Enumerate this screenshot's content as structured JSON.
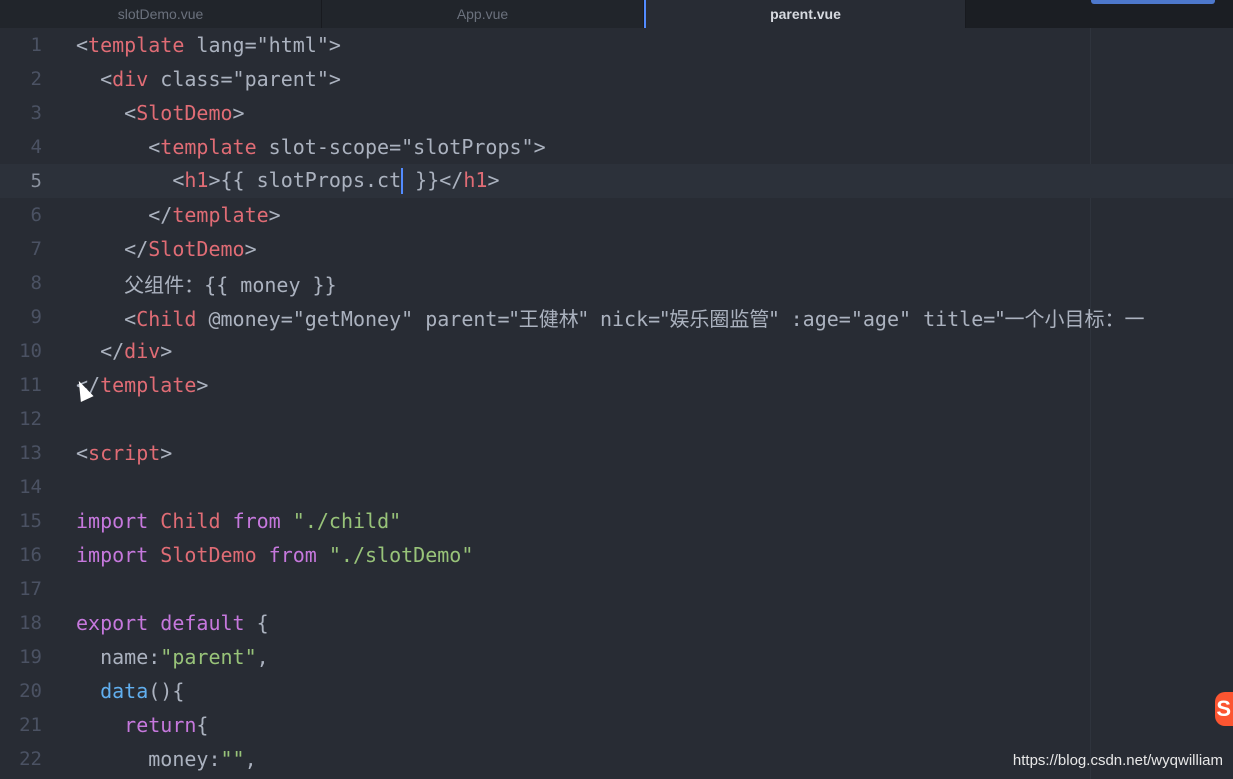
{
  "tabs": [
    {
      "label": "slotDemo.vue",
      "active": false
    },
    {
      "label": "App.vue",
      "active": false
    },
    {
      "label": "parent.vue",
      "active": true
    }
  ],
  "colors": {
    "background": "#282c34",
    "tag": "#e06c75",
    "attribute": "#d19a66",
    "string": "#98c379",
    "keyword": "#c678dd",
    "function": "#61afef",
    "cursor": "#528bff"
  },
  "editor": {
    "cursor_line": 5,
    "lines": [
      {
        "n": "1",
        "t": [
          [
            "<",
            "t-plain"
          ],
          [
            "template",
            "t-tag"
          ],
          [
            " lang=",
            "t-plain"
          ],
          [
            "\"html\"",
            "t-plain"
          ],
          [
            ">",
            "t-plain"
          ]
        ]
      },
      {
        "n": "2",
        "t": [
          [
            "  <",
            "t-plain"
          ],
          [
            "div",
            "t-tag"
          ],
          [
            " class=",
            "t-plain"
          ],
          [
            "\"parent\"",
            "t-plain"
          ],
          [
            ">",
            "t-plain"
          ]
        ]
      },
      {
        "n": "3",
        "t": [
          [
            "    <",
            "t-plain"
          ],
          [
            "SlotDemo",
            "t-tag"
          ],
          [
            ">",
            "t-plain"
          ]
        ]
      },
      {
        "n": "4",
        "t": [
          [
            "      <",
            "t-plain"
          ],
          [
            "template",
            "t-tag"
          ],
          [
            " slot-scope=",
            "t-plain"
          ],
          [
            "\"slotProps\"",
            "t-plain"
          ],
          [
            ">",
            "t-plain"
          ]
        ]
      },
      {
        "n": "5",
        "t": [
          [
            "        <",
            "t-plain"
          ],
          [
            "h1",
            "t-tag"
          ],
          [
            ">{{ slotProps.ct",
            "t-plain"
          ],
          [
            "|",
            "caret"
          ],
          [
            " }}</",
            "t-plain"
          ],
          [
            "h1",
            "t-tag"
          ],
          [
            ">",
            "t-plain"
          ]
        ]
      },
      {
        "n": "6",
        "t": [
          [
            "      </",
            "t-plain"
          ],
          [
            "template",
            "t-tag"
          ],
          [
            ">",
            "t-plain"
          ]
        ]
      },
      {
        "n": "7",
        "t": [
          [
            "    </",
            "t-plain"
          ],
          [
            "SlotDemo",
            "t-tag"
          ],
          [
            ">",
            "t-plain"
          ]
        ]
      },
      {
        "n": "8",
        "t": [
          [
            "    ",
            "t-plain"
          ],
          [
            "父组件：",
            "t-plain t-cjk"
          ],
          [
            "{{ money }}",
            "t-plain"
          ]
        ]
      },
      {
        "n": "9",
        "t": [
          [
            "    <",
            "t-plain"
          ],
          [
            "Child",
            "t-tag"
          ],
          [
            " @money=",
            "t-plain"
          ],
          [
            "\"getMoney\"",
            "t-plain"
          ],
          [
            " parent=",
            "t-plain"
          ],
          [
            "\"王健林\"",
            "t-plain t-cjk"
          ],
          [
            " nick=",
            "t-plain"
          ],
          [
            "\"娱乐圈监管\"",
            "t-plain t-cjk"
          ],
          [
            " :age=",
            "t-plain"
          ],
          [
            "\"age\"",
            "t-plain"
          ],
          [
            " title=",
            "t-plain"
          ],
          [
            "\"一个小目标：一",
            "t-plain t-cjk"
          ]
        ]
      },
      {
        "n": "10",
        "t": [
          [
            "  </",
            "t-plain"
          ],
          [
            "div",
            "t-tag"
          ],
          [
            ">",
            "t-plain"
          ]
        ]
      },
      {
        "n": "11",
        "t": [
          [
            "</",
            "t-plain"
          ],
          [
            "template",
            "t-tag"
          ],
          [
            ">",
            "t-plain"
          ]
        ]
      },
      {
        "n": "12",
        "t": []
      },
      {
        "n": "13",
        "t": [
          [
            "<",
            "t-plain"
          ],
          [
            "script",
            "t-tag"
          ],
          [
            ">",
            "t-plain"
          ]
        ]
      },
      {
        "n": "14",
        "t": []
      },
      {
        "n": "15",
        "t": [
          [
            "import",
            "t-kw"
          ],
          [
            " ",
            "t-plain"
          ],
          [
            "Child",
            "t-var"
          ],
          [
            " ",
            "t-plain"
          ],
          [
            "from",
            "t-kw"
          ],
          [
            " ",
            "t-plain"
          ],
          [
            "\"./child\"",
            "t-str"
          ]
        ]
      },
      {
        "n": "16",
        "t": [
          [
            "import",
            "t-kw"
          ],
          [
            " ",
            "t-plain"
          ],
          [
            "SlotDemo",
            "t-var"
          ],
          [
            " ",
            "t-plain"
          ],
          [
            "from",
            "t-kw"
          ],
          [
            " ",
            "t-plain"
          ],
          [
            "\"./slotDemo\"",
            "t-str"
          ]
        ]
      },
      {
        "n": "17",
        "t": []
      },
      {
        "n": "18",
        "t": [
          [
            "export",
            "t-kw"
          ],
          [
            " ",
            "t-plain"
          ],
          [
            "default",
            "t-kw"
          ],
          [
            " {",
            "t-plain"
          ]
        ]
      },
      {
        "n": "19",
        "t": [
          [
            "  name:",
            "t-plain"
          ],
          [
            "\"parent\"",
            "t-str"
          ],
          [
            ",",
            "t-plain"
          ]
        ]
      },
      {
        "n": "20",
        "t": [
          [
            "  ",
            "t-plain"
          ],
          [
            "data",
            "t-fn"
          ],
          [
            "(){",
            "t-plain"
          ]
        ]
      },
      {
        "n": "21",
        "t": [
          [
            "    ",
            "t-plain"
          ],
          [
            "return",
            "t-kw"
          ],
          [
            "{",
            "t-plain"
          ]
        ]
      },
      {
        "n": "22",
        "t": [
          [
            "      money:",
            "t-plain"
          ],
          [
            "\"\"",
            "t-str"
          ],
          [
            ",",
            "t-plain"
          ]
        ]
      }
    ]
  },
  "watermark": "https://blog.csdn.net/wyqwilliam",
  "badge_letter": "S"
}
